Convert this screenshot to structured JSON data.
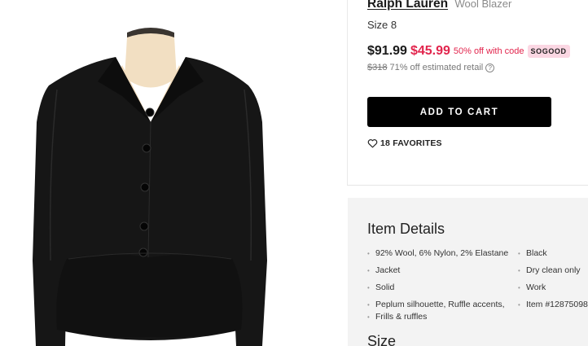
{
  "product": {
    "brand": "Ralph Lauren",
    "name": "Wool Blazer",
    "size_label": "Size 8"
  },
  "pricing": {
    "price": "$91.99",
    "sale_price": "$45.99",
    "promo_text": "50% off with code",
    "promo_code": "SOGOOD",
    "retail_price": "$318",
    "retail_text": "71% off estimated retail",
    "help_glyph": "?"
  },
  "actions": {
    "add_to_cart": "ADD TO CART",
    "favorites": "18 FAVORITES"
  },
  "details": {
    "title": "Item Details",
    "left": [
      "92% Wool, 6% Nylon, 2% Elastane",
      "Jacket",
      "Solid",
      "Peplum silhouette, Ruffle accents,",
      "Frills & ruffles"
    ],
    "right": [
      "Black",
      "Dry clean only",
      "Work",
      "Item #12875098"
    ]
  },
  "size_section": {
    "title": "Size"
  },
  "colors": {
    "sale_red": "#e2254d",
    "promo_pink": "#fbd7e3",
    "button_black": "#000000",
    "panel_gray": "#f3f3f3"
  },
  "icons": [
    "heart-icon",
    "help-circle-icon"
  ]
}
